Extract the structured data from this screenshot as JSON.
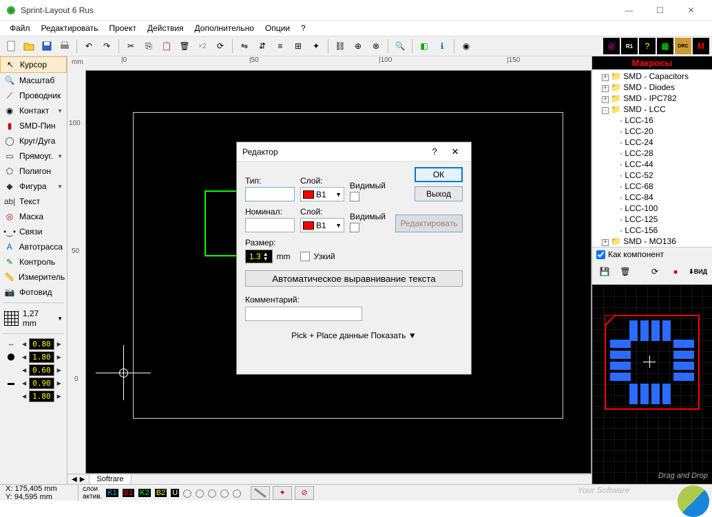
{
  "window": {
    "title": "Sprint-Layout 6 Rus"
  },
  "menu": [
    "Файл",
    "Редактировать",
    "Проект",
    "Действия",
    "Дополнительно",
    "Опции",
    "?"
  ],
  "tools": [
    {
      "icon": "cursor",
      "label": "Курсор",
      "selected": true
    },
    {
      "icon": "zoom",
      "label": "Масштаб"
    },
    {
      "icon": "track",
      "label": "Проводник"
    },
    {
      "icon": "pad",
      "label": "Контакт",
      "dd": true
    },
    {
      "icon": "smd",
      "label": "SMD-Пин"
    },
    {
      "icon": "circle",
      "label": "Круг/Дуга"
    },
    {
      "icon": "rect",
      "label": "Прямоуг.",
      "dd": true
    },
    {
      "icon": "poly",
      "label": "Полигон"
    },
    {
      "icon": "shape",
      "label": "Фигура",
      "dd": true
    },
    {
      "icon": "text",
      "label": "Текст"
    },
    {
      "icon": "mask",
      "label": "Маска"
    },
    {
      "icon": "link",
      "label": "Связи"
    },
    {
      "icon": "auto",
      "label": "Автотрасса"
    },
    {
      "icon": "check",
      "label": "Контроль"
    },
    {
      "icon": "measure",
      "label": "Измеритель"
    },
    {
      "icon": "photo",
      "label": "Фотовид"
    }
  ],
  "grid_label": "1,27 mm",
  "track_params": [
    {
      "icon": "tw",
      "val": "0.80"
    },
    {
      "icon": "pd1",
      "val": "1.80"
    },
    {
      "icon": "pd2",
      "val": "0.60"
    },
    {
      "icon": "sm1",
      "val": "0.90"
    },
    {
      "icon": "sm2",
      "val": "1.80"
    }
  ],
  "ruler": {
    "unit": "mm",
    "marks_h": [
      0,
      50,
      100,
      150
    ],
    "marks_v": [
      100,
      50,
      0
    ]
  },
  "tab_name": "Softrare",
  "macros": {
    "title": "Макросы",
    "tree": [
      {
        "t": "SMD - Capacitors",
        "exp": "+"
      },
      {
        "t": "SMD - Diodes",
        "exp": "+"
      },
      {
        "t": "SMD - IPC782",
        "exp": "+"
      },
      {
        "t": "SMD - LCC",
        "exp": "-",
        "children": [
          "LCC-16",
          "LCC-20",
          "LCC-24",
          "LCC-28",
          "LCC-44",
          "LCC-52",
          "LCC-68",
          "LCC-84",
          "LCC-100",
          "LCC-125",
          "LCC-156"
        ]
      },
      {
        "t": "SMD - MO136",
        "exp": "+"
      }
    ],
    "as_component": "Как компонент",
    "view_label": "ВИД",
    "dnd": "Drag and Drop"
  },
  "status": {
    "x_label": "X:",
    "x": "175,405 mm",
    "y_label": "Y:",
    "y": "94,595 mm",
    "layers_label": "слои",
    "active_label": "актив.",
    "layers": [
      "K1",
      "B1",
      "K2",
      "B2",
      "U"
    ]
  },
  "dialog": {
    "title": "Редактор",
    "type_label": "Тип:",
    "layer_label": "Слой:",
    "visible_label": "Видимый",
    "layer_value": "B1",
    "nominal_label": "Номинал:",
    "size_label": "Размер:",
    "size_value": "1.3",
    "size_unit": "mm",
    "narrow_label": "Узкий",
    "auto_align": "Автоматическое выравнивание текста",
    "comment_label": "Комментарий:",
    "pickplace": "Pick + Place данные Показать",
    "ok": "ОК",
    "exit": "Выход",
    "edit": "Редактировать"
  },
  "watermark": "Your Software"
}
